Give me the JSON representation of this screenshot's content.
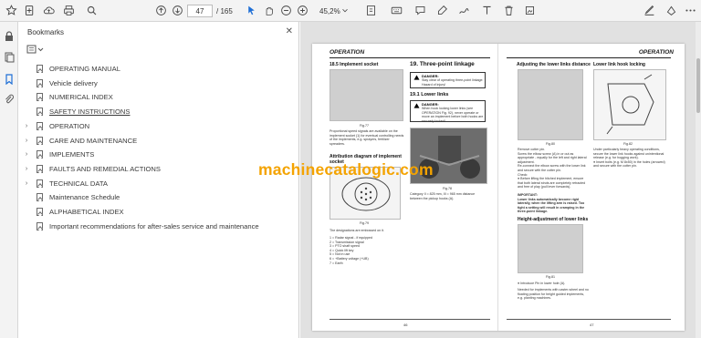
{
  "toolbar": {
    "page_current": "47",
    "page_total": "/ 165",
    "zoom": "45,2%"
  },
  "bookmarks": {
    "title": "Bookmarks",
    "items": [
      {
        "label": "OPERATING MANUAL",
        "expandable": false,
        "underline": false
      },
      {
        "label": "Vehicle delivery",
        "expandable": false,
        "underline": false
      },
      {
        "label": "NUMERICAL INDEX",
        "expandable": false,
        "underline": false
      },
      {
        "label": "SAFETY INSTRUCTIONS",
        "expandable": false,
        "underline": true
      },
      {
        "label": "OPERATION",
        "expandable": true,
        "underline": false
      },
      {
        "label": "CARE AND MAINTENANCE",
        "expandable": true,
        "underline": false
      },
      {
        "label": "IMPLEMENTS",
        "expandable": true,
        "underline": false
      },
      {
        "label": "FAULTS AND REMEDIAL ACTIONS",
        "expandable": true,
        "underline": false
      },
      {
        "label": "TECHNICAL DATA",
        "expandable": true,
        "underline": false
      },
      {
        "label": "Maintenance Schedule",
        "expandable": false,
        "underline": false
      },
      {
        "label": "ALPHABETICAL INDEX",
        "expandable": false,
        "underline": false
      },
      {
        "label": "Important recommendations for after-sales service and maintenance",
        "expandable": false,
        "underline": false
      }
    ]
  },
  "doc": {
    "left_header": "OPERATION",
    "sec_implement_socket": "18.5 Implement socket",
    "sec_three_point": "19.  Three-point linkage",
    "sec_lower_links": "19.1 Lower links",
    "danger_label": "DANGER:",
    "danger1_text": "Stay clear of operating three-point linkage. Hazard of injury!",
    "danger2_text": "When hook locking lower links (see OPERATION Fig. 92), never operate or move an implement before both hooks are securely locked!",
    "fig77": "Fig.77",
    "fig78": "Fig.78",
    "fig79": "Fig.79",
    "attrib_title": "Attribution diagram of implement socket",
    "para1": "Proportional speed signals are available on the implement socket (1) for eventual controlling needs of the implements, e.g. sprayers, fertilizer spreaders.",
    "para2": "Category II = 825 mm, III = 965 mm distance between the pickup hooks (A).",
    "designations": "The designations are embossed on it.",
    "pin_list": "1 = Radar signal - if equipped\n2 = Transmission signal\n3 = PTO shaft speed\n4 = Quick lift key\n5 = Not in use\n6 = +Battery voltage (+UB)\n7 = Earth",
    "page_left": "46",
    "adjust_title": "Adjusting the lower links distance",
    "hook_title": "Lower link hook locking",
    "fig80": "Fig.80",
    "fig81": "Fig.81",
    "fig82": "Fig.82",
    "para3": "Remove cotter pin.\nScrew the elbow screw (A) in or out as appropriate - equally for the left and right lateral adjustment.\nRe-connect the elbow screw with the lower link and secure with the cotter pin.\nCheck:\n● Before lifting the hitched implement, ensure that both lateral struts are completely retracted and free of play (pull lever forwards).",
    "important": "IMPORTANT:\nLower links automatically become rigid laterally, when the lifting arm is raised. Too tight a setting will result in cramping in the three-point linkage.",
    "height_title": "Height-adjustment of lower links",
    "para4": "● Introduce Pin in lower hole (A).",
    "para5": "Needed for implements with caster-wheel and no floating position for height guided implements, e.g. planting machines.",
    "para6": "Under particularly heavy operating conditions, secure the lower link hooks against unintentional release (e.g. for hogging work).\n● Insert bolts (e.g. M 8x50) in the holes (arrowed) and secure with the cotter pin.",
    "page_right": "47"
  },
  "watermark": "machinecatalogic.com",
  "colors": {
    "watermark": "#f4a300",
    "toolbar_bg": "#f3f3f3",
    "view_bg": "#e1e1e1"
  }
}
